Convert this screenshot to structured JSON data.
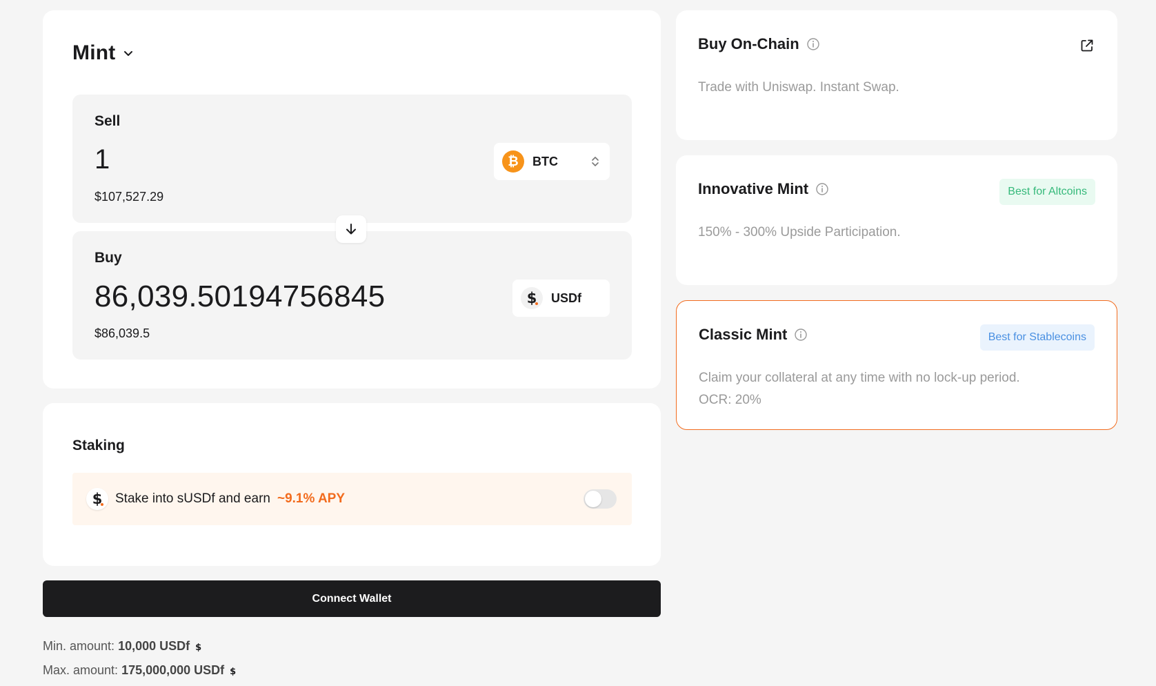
{
  "mint": {
    "title": "Mint",
    "sell": {
      "label": "Sell",
      "amount": "1",
      "usd_value": "$107,527.29",
      "token": "BTC"
    },
    "buy": {
      "label": "Buy",
      "amount": "86,039.50194756845",
      "usd_value": "$86,039.5",
      "token": "USDf"
    }
  },
  "staking": {
    "title": "Staking",
    "text": "Stake into sUSDf and earn",
    "apy": "~9.1% APY",
    "enabled": false
  },
  "connect_wallet_label": "Connect Wallet",
  "limits": {
    "min_label": "Min. amount:",
    "min_value": "10,000 USDf",
    "max_label": "Max. amount:",
    "max_value": "175,000,000 USDf"
  },
  "options": {
    "onchain": {
      "title": "Buy On-Chain",
      "description": "Trade with Uniswap. Instant Swap."
    },
    "innovative": {
      "title": "Innovative Mint",
      "badge": "Best for Altcoins",
      "description": "150% - 300% Upside Participation."
    },
    "classic": {
      "title": "Classic Mint",
      "badge": "Best for Stablecoins",
      "description": "Claim your collateral at any time with no lock-up period.",
      "ocr": "OCR: 20%",
      "selected": true
    }
  },
  "colors": {
    "accent": "#f26b1d",
    "btc": "#f7931a",
    "badge_green": "#35b97a",
    "badge_blue": "#4a90e2"
  },
  "icons": {
    "btc": "bitcoin-icon",
    "usdf": "usdf-dollar-icon",
    "swap": "arrow-down-icon",
    "info": "info-icon",
    "external": "external-link-icon"
  }
}
